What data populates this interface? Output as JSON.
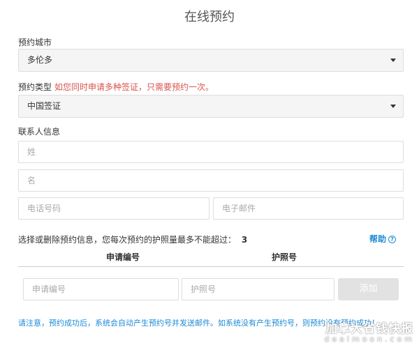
{
  "page": {
    "title": "在线预约"
  },
  "city": {
    "label": "预约城市",
    "value": "多伦多"
  },
  "type": {
    "label": "预约类型",
    "note": "如您同时申请多种签证，只需要预约一次。",
    "value": "中国签证"
  },
  "contact": {
    "label": "联系人信息",
    "last_name_placeholder": "姓",
    "first_name_placeholder": "名",
    "phone_placeholder": "电话号码",
    "email_placeholder": "电子邮件"
  },
  "booking": {
    "instruction": "选择或删除预约信息，您每次预约的护照量最多不能超过：",
    "max_count": "3",
    "help_label": "帮助",
    "help_icon_glyph": "?",
    "col_application": "申请编号",
    "col_passport": "护照号",
    "application_placeholder": "申请编号",
    "passport_placeholder": "护照号",
    "add_label": "添加"
  },
  "notice": {
    "text": "请注意，预约成功后，系统会自动产生预约号并发送邮件。如系统没有产生预约号，则预约没有预约成功！"
  },
  "watermark": {
    "cn": "加拿大省钱快报",
    "en": "dealmoon.com"
  },
  "colors": {
    "accent": "#1b8ad6",
    "warning": "#d9534f",
    "field_border": "#dddddd",
    "select_bg": "#f5f5f5"
  }
}
